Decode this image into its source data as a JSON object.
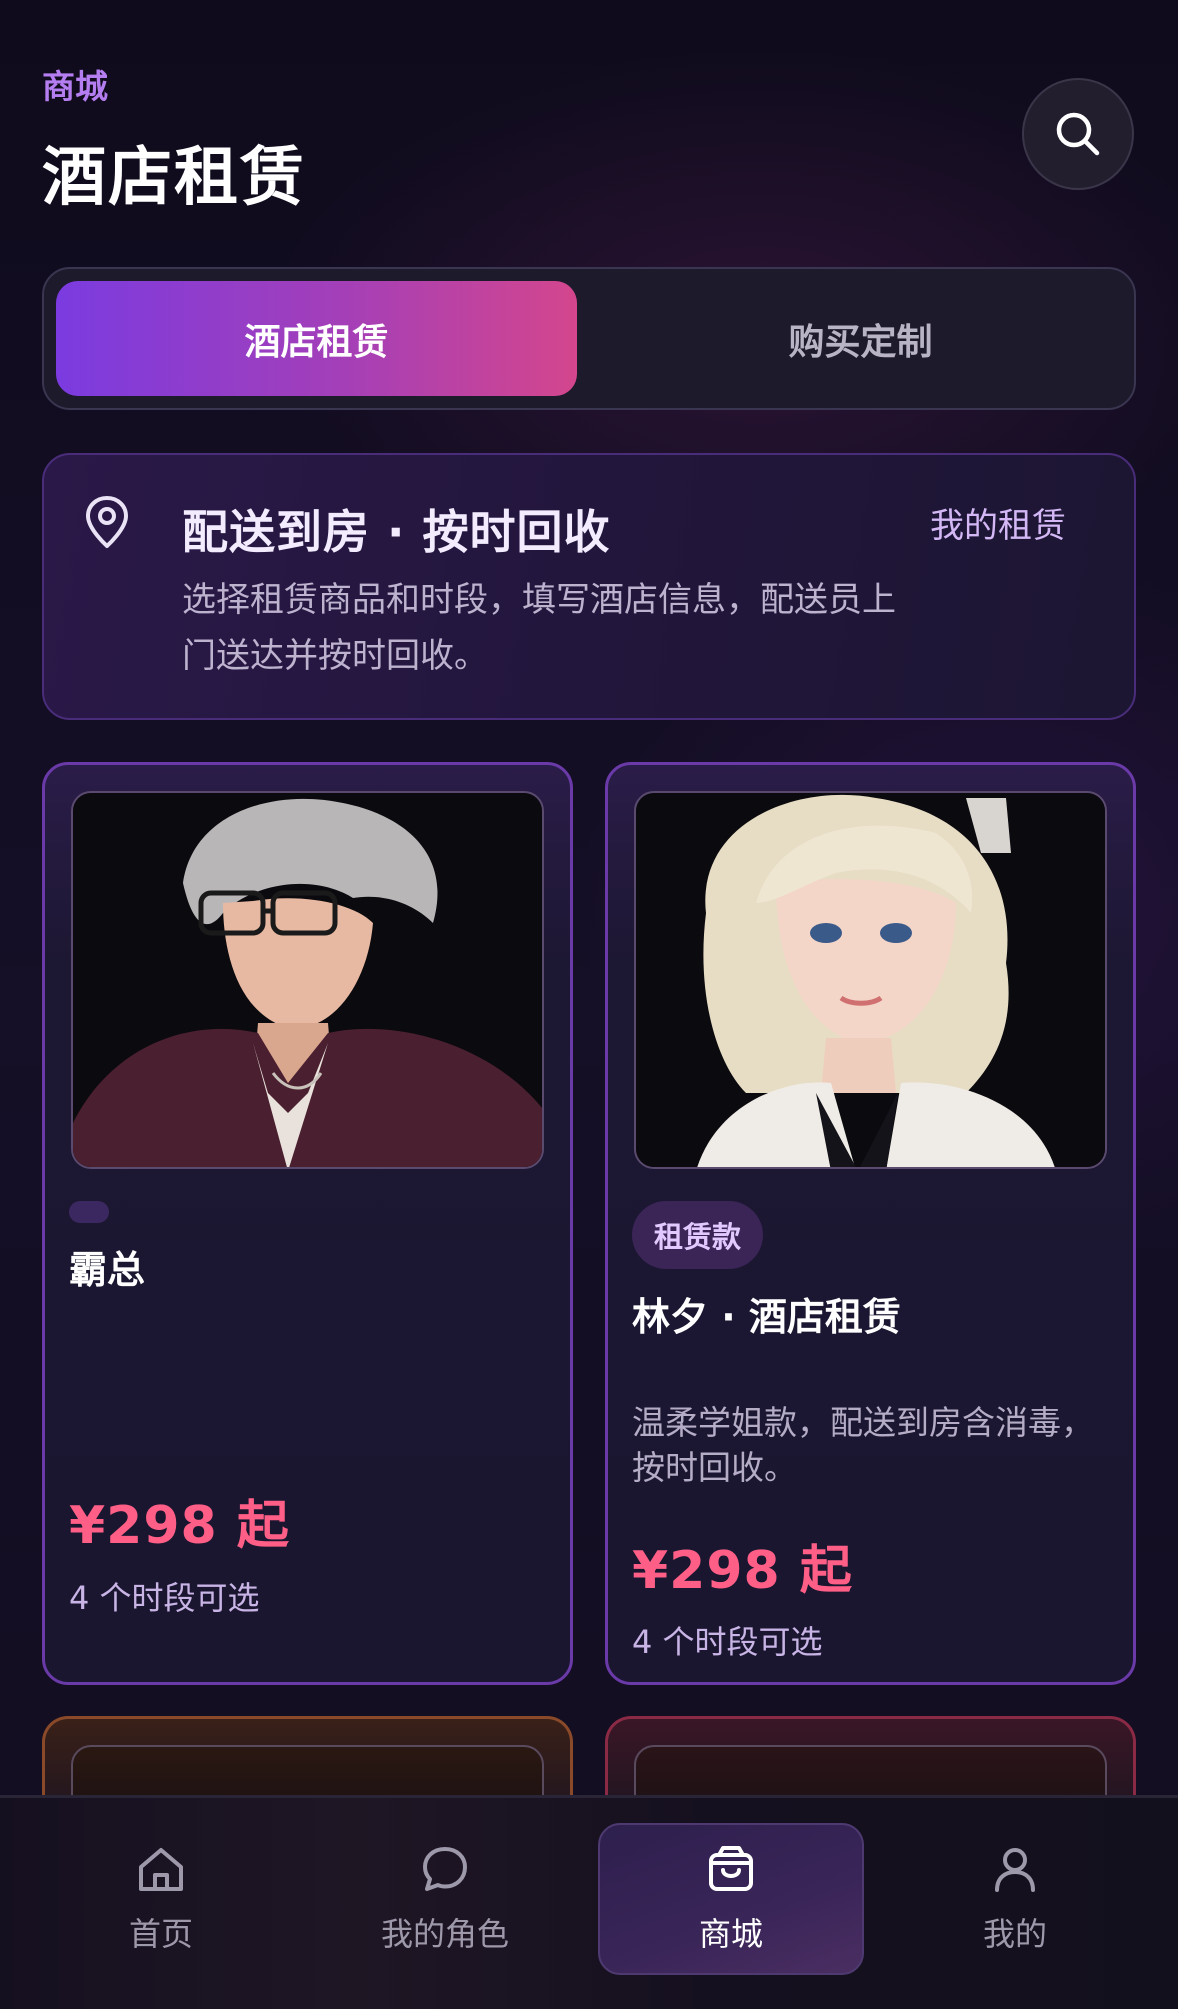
{
  "header": {
    "eyebrow": "商城",
    "title": "酒店租赁"
  },
  "tabs": [
    {
      "label": "酒店租赁",
      "active": true
    },
    {
      "label": "购买定制",
      "active": false
    }
  ],
  "banner": {
    "title": "配送到房 · 按时回收",
    "link": "我的租赁",
    "description": "选择租赁商品和时段，填写酒店信息，配送员上门送达并按时回收。"
  },
  "products": [
    {
      "image": "silver-haired-man-with-glasses",
      "badge": "",
      "name": "霸总",
      "description": "",
      "price": "¥298 起",
      "slots": "4 个时段可选"
    },
    {
      "image": "blonde-woman-portrait",
      "badge": "租赁款",
      "name": "林夕 · 酒店租赁",
      "description": "温柔学姐款，配送到房含消毒，按时回收。",
      "price": "¥298 起",
      "slots": "4 个时段可选"
    }
  ],
  "nav": [
    {
      "label": "首页",
      "icon": "home-icon",
      "active": false
    },
    {
      "label": "我的角色",
      "icon": "chat-bubble-icon",
      "active": false
    },
    {
      "label": "商城",
      "icon": "shopping-bag-icon",
      "active": true
    },
    {
      "label": "我的",
      "icon": "user-icon",
      "active": false
    }
  ],
  "colors": {
    "accent_purple": "#7b3be0",
    "accent_pink": "#d4468d",
    "price": "#ff5f86",
    "background": "#120e22"
  }
}
